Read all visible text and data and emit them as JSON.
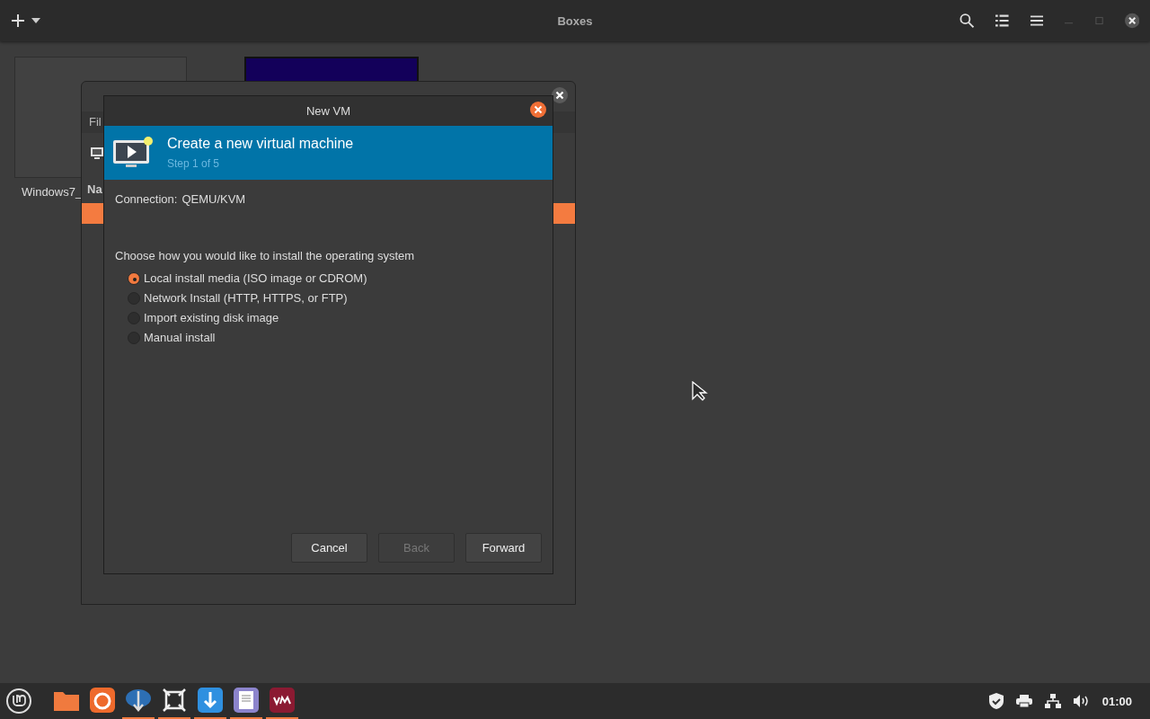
{
  "window": {
    "title": "Boxes"
  },
  "boxes": [
    {
      "kind": "blank",
      "label": "Windows7_"
    },
    {
      "kind": "screen"
    }
  ],
  "background_window": {
    "menu": "Fil",
    "column_header": "Na"
  },
  "dialog": {
    "title": "New VM",
    "heading": "Create a new virtual machine",
    "step": "Step 1 of 5",
    "connection_label": "Connection:",
    "connection_value": "QEMU/KVM",
    "prompt": "Choose how you would like to install the operating system",
    "options": [
      {
        "label": "Local install media (ISO image or CDROM)",
        "selected": true
      },
      {
        "label": "Network Install (HTTP, HTTPS, or FTP)",
        "selected": false
      },
      {
        "label": "Import existing disk image",
        "selected": false
      },
      {
        "label": "Manual install",
        "selected": false
      }
    ],
    "buttons": [
      {
        "label": "Cancel",
        "disabled": false
      },
      {
        "label": "Back",
        "disabled": true
      },
      {
        "label": "Forward",
        "disabled": false
      }
    ]
  },
  "taskbar": {
    "apps": [
      {
        "kind": "files",
        "running": false
      },
      {
        "kind": "browser",
        "running": false
      },
      {
        "kind": "transfer",
        "running": true
      },
      {
        "kind": "frame",
        "running": true
      },
      {
        "kind": "download",
        "running": true
      },
      {
        "kind": "notes",
        "running": true
      },
      {
        "kind": "vm",
        "running": true
      }
    ],
    "clock": "01:00"
  }
}
